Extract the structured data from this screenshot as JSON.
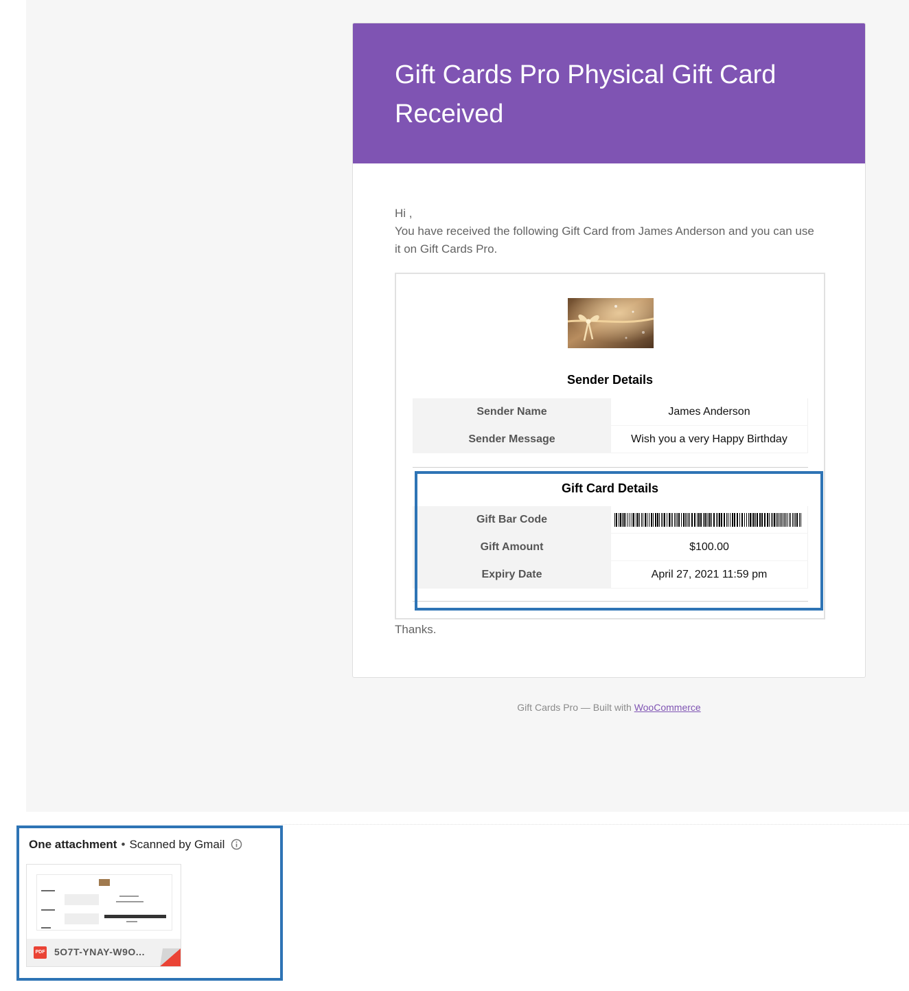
{
  "email": {
    "title": "Gift Cards Pro Physical Gift Card Received",
    "greeting": "Hi ,",
    "intro": "You have received the following Gift Card from James Anderson and you can use it on Gift Cards Pro.",
    "thanks": "Thanks.",
    "accent_color": "#7f54b3",
    "gift_card_image": "gold-ribbon-gift-card-image",
    "sender_section": {
      "title": "Sender Details",
      "rows": [
        {
          "label": "Sender Name",
          "value": "James Anderson"
        },
        {
          "label": "Sender Message",
          "value": "Wish you a very Happy Birthday"
        }
      ]
    },
    "gift_section": {
      "title": "Gift Card Details",
      "barcode_label": "Gift Bar Code",
      "rows": [
        {
          "label": "Gift Amount",
          "value": "$100.00"
        },
        {
          "label": "Expiry Date",
          "value": "April 27, 2021 11:59 pm"
        }
      ]
    }
  },
  "footer": {
    "text": "Gift Cards Pro — Built with ",
    "link_label": "WooCommerce"
  },
  "attachments": {
    "heading": "One attachment",
    "scan_status": "Scanned by Gmail",
    "info_icon": "info-icon",
    "file": {
      "type_badge": "PDF",
      "name": "5O7T-YNAY-W9O..."
    }
  },
  "highlight_color": "#2e74b5"
}
